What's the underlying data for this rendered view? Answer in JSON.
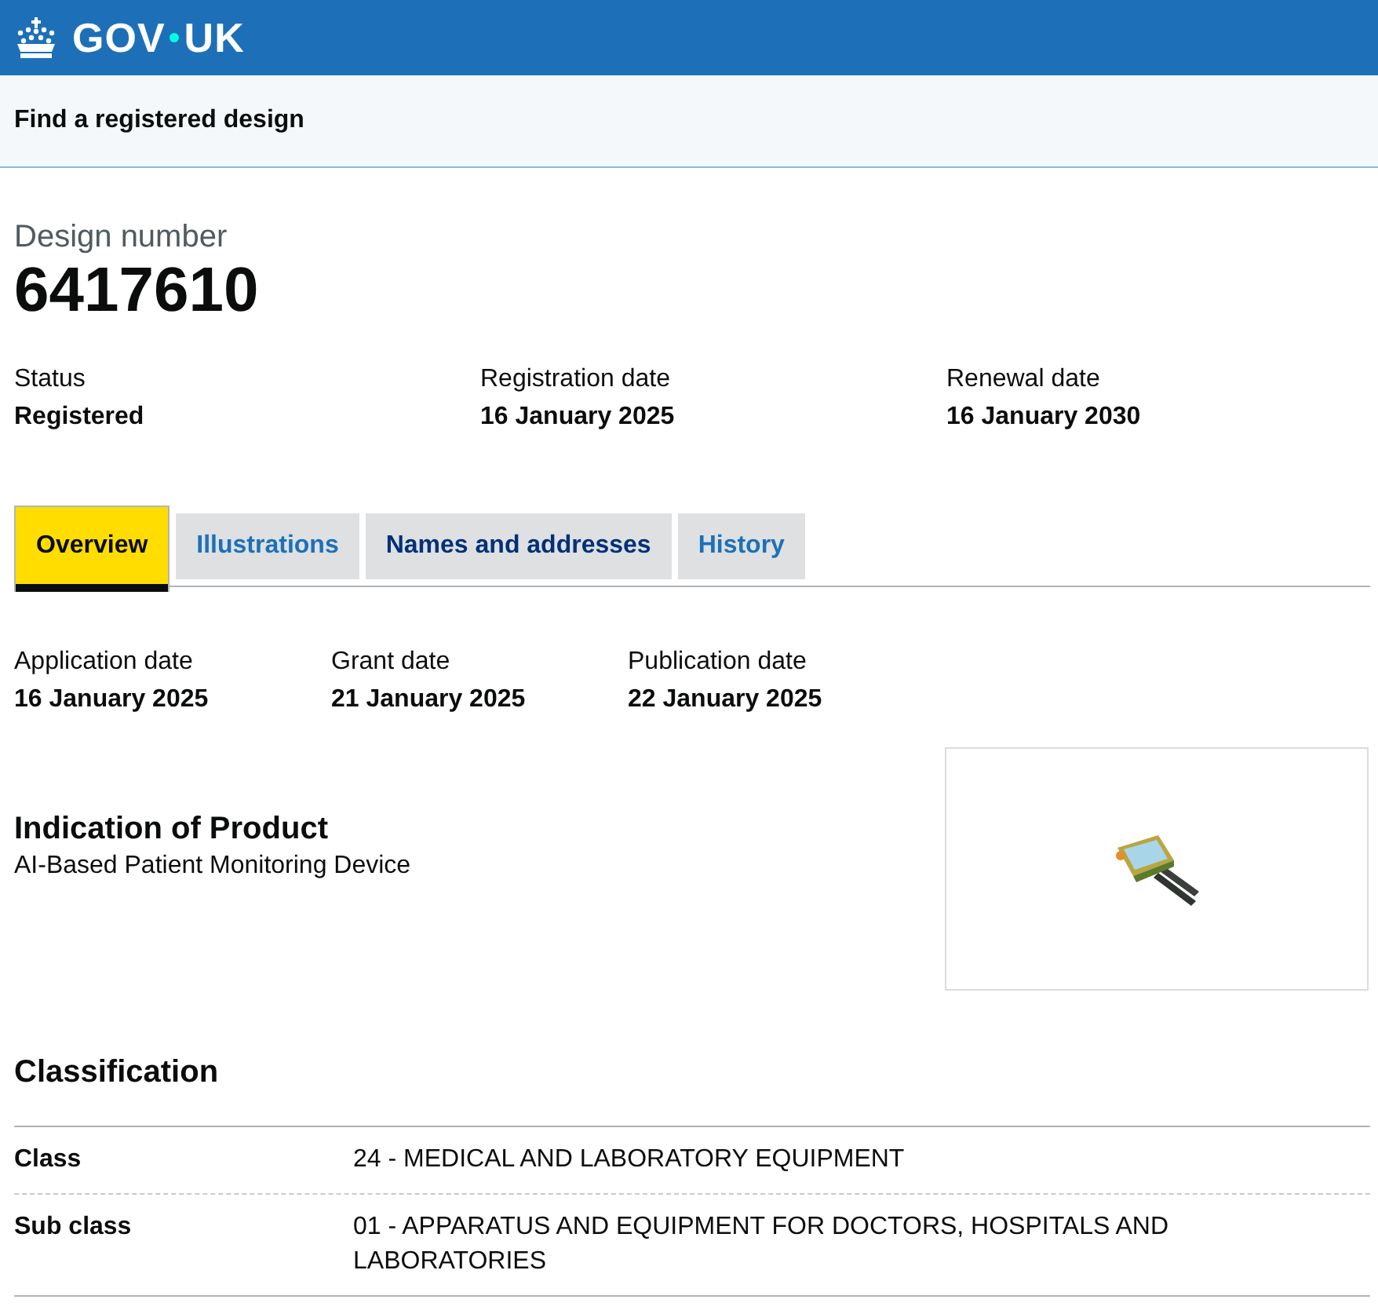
{
  "header": {
    "logo": [
      "GOV",
      "UK"
    ]
  },
  "service": {
    "title": "Find a registered design"
  },
  "design": {
    "label": "Design number",
    "number": "6417610"
  },
  "summary": [
    {
      "label": "Status",
      "value": "Registered"
    },
    {
      "label": "Registration date",
      "value": "16 January 2025"
    },
    {
      "label": "Renewal date",
      "value": "16 January 2030"
    }
  ],
  "tabs": [
    {
      "label": "Overview",
      "selected": true,
      "visited": false
    },
    {
      "label": "Illustrations",
      "selected": false,
      "visited": false
    },
    {
      "label": "Names and addresses",
      "selected": false,
      "visited": true
    },
    {
      "label": "History",
      "selected": false,
      "visited": false
    }
  ],
  "dates": [
    {
      "label": "Application date",
      "value": "16 January 2025"
    },
    {
      "label": "Grant date",
      "value": "21 January 2025"
    },
    {
      "label": "Publication date",
      "value": "22 January 2025"
    }
  ],
  "product": {
    "heading": "Indication of Product",
    "description": "AI-Based Patient Monitoring Device"
  },
  "classification": {
    "heading": "Classification",
    "rows": [
      {
        "label": "Class",
        "value": "24 - MEDICAL AND LABORATORY EQUIPMENT"
      },
      {
        "label": "Sub class",
        "value": "01 - APPARATUS AND EQUIPMENT FOR DOCTORS, HOSPITALS AND LABORATORIES"
      }
    ]
  }
}
